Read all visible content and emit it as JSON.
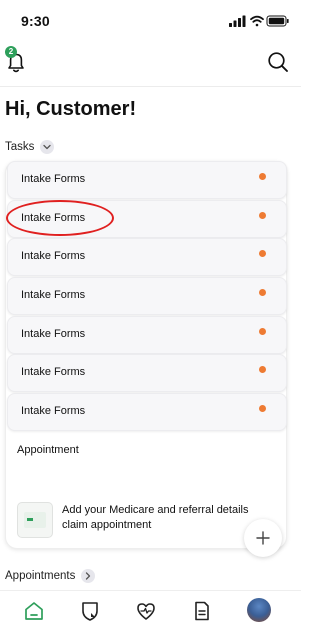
{
  "status_bar": {
    "time": "9:30"
  },
  "header": {
    "notification_count": "2"
  },
  "greeting": "Hi, Customer!",
  "tasks": {
    "label": "Tasks",
    "items": [
      {
        "label": "Intake Forms"
      },
      {
        "label": "Intake Forms"
      },
      {
        "label": "Intake Forms"
      },
      {
        "label": "Intake Forms"
      },
      {
        "label": "Intake Forms"
      },
      {
        "label": "Intake Forms"
      },
      {
        "label": "Intake Forms"
      }
    ],
    "status_color": "#ee7b33"
  },
  "appointment": {
    "title": "Appointment",
    "line1": "Add your Medicare and referral details",
    "line2": "claim appointment",
    "add_icon": "plus-icon"
  },
  "appointments": {
    "label": "Appointments"
  },
  "tab_bar": {
    "items": [
      "home-icon",
      "shield-icon",
      "heart-pulse-icon",
      "document-icon",
      "avatar"
    ]
  },
  "colors": {
    "accent": "#2e9f5b",
    "highlight": "#e02020"
  }
}
